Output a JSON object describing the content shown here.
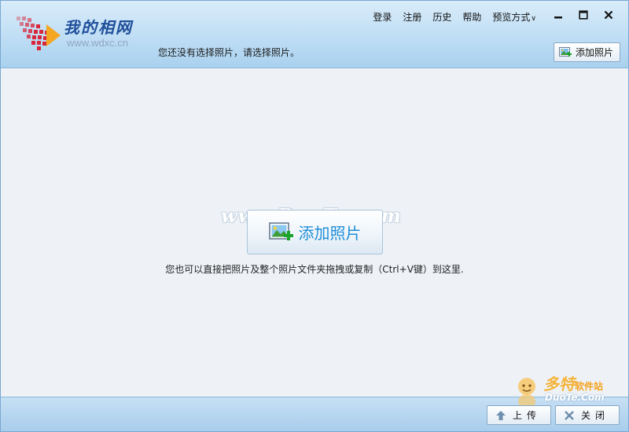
{
  "app": {
    "logo_title": "我的相网",
    "logo_url": "www.wdxc.cn",
    "status_text": "您还没有选择照片，请选择照片。"
  },
  "nav": {
    "login": "登录",
    "register": "注册",
    "history": "历史",
    "help": "帮助",
    "preview_mode": "预览方式"
  },
  "window_controls": {
    "minimize_icon": "minimize-icon",
    "maximize_icon": "maximize-icon",
    "close_icon": "close-icon"
  },
  "toolbar": {
    "add_photos_label": "添加照片"
  },
  "main": {
    "watermark": "www.DuoTe.com",
    "add_photos_big_label": "添加照片",
    "hint": "您也可以直接把照片及整个照片文件夹拖拽或复制（Ctrl+V键）到这里."
  },
  "footer": {
    "upload_label": "上传",
    "close_label": "关闭"
  },
  "brand_watermark": {
    "name": "多特",
    "suffix": "软件站",
    "domain": "DuoTe.Com"
  },
  "colors": {
    "header_gradient_top": "#d9ecfa",
    "header_gradient_bottom": "#a9d1ef",
    "accent_blue": "#1f8fd8",
    "logo_red": "#d9263b"
  }
}
